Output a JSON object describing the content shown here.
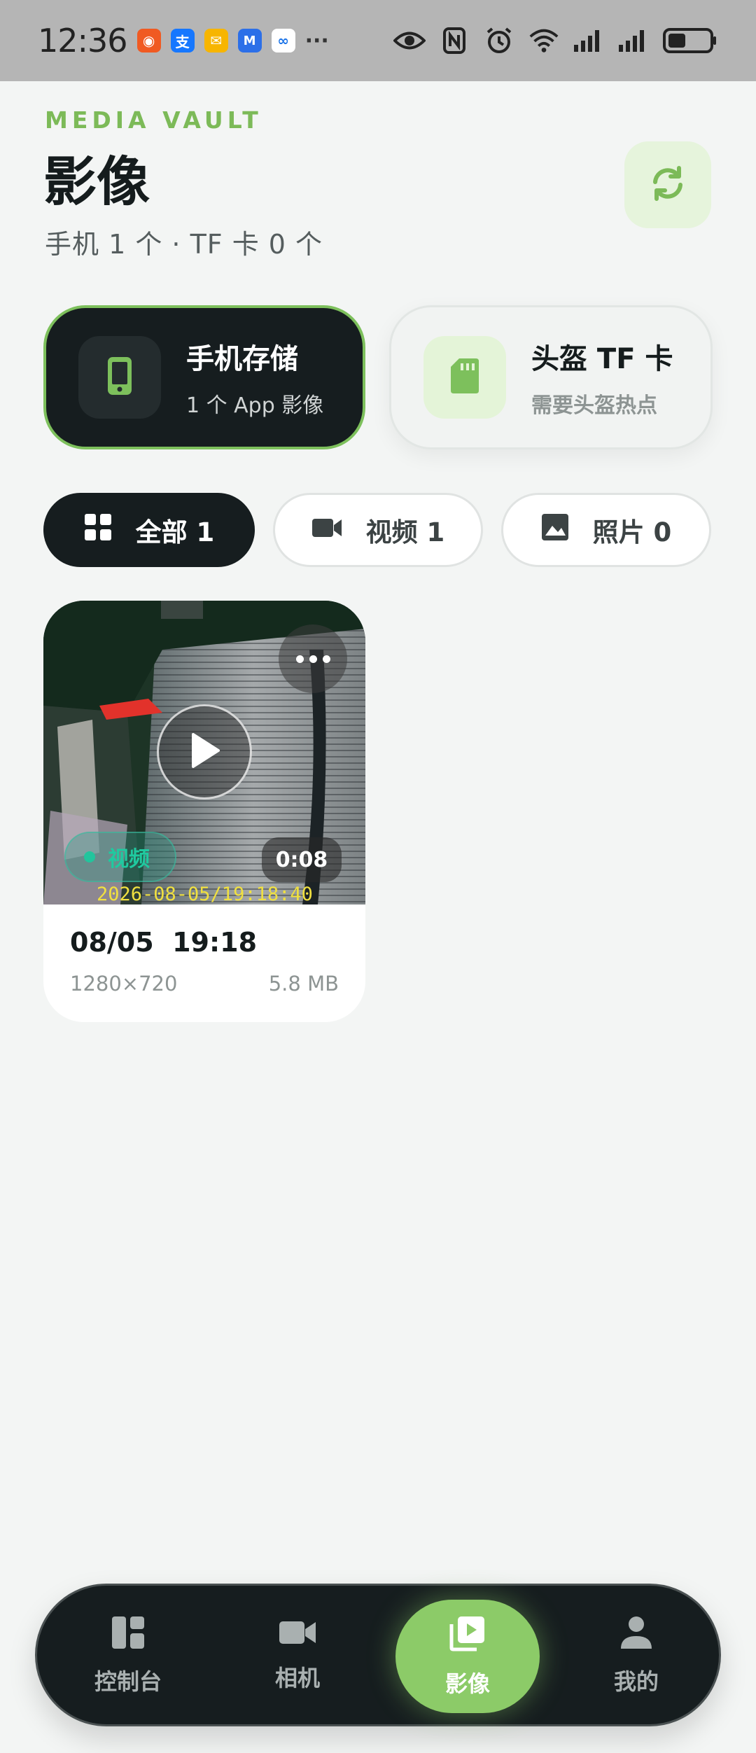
{
  "status_bar": {
    "time": "12:36",
    "more": "···"
  },
  "header": {
    "eyebrow": "MEDIA VAULT",
    "title": "影像",
    "subtitle": "手机 1 个 · TF 卡 0 个"
  },
  "storage": [
    {
      "title": "手机存储",
      "subtitle": "1 个 App 影像",
      "icon": "phone-icon",
      "active": true
    },
    {
      "title": "头盔 TF 卡",
      "subtitle": "需要头盔热点",
      "icon": "sd-card-icon",
      "active": false
    }
  ],
  "filters": [
    {
      "label": "全部 1",
      "icon": "grid-icon",
      "active": true
    },
    {
      "label": "视频 1",
      "icon": "video-camera-icon",
      "active": false
    },
    {
      "label": "照片 0",
      "icon": "image-icon",
      "active": false
    }
  ],
  "media": [
    {
      "type_badge": "视频",
      "duration": "0:08",
      "stamp": "2026-08-05/19:18:40",
      "date": "08/05  19:18",
      "resolution": "1280×720",
      "size": "5.8 MB"
    }
  ],
  "nav": [
    {
      "label": "控制台",
      "icon": "dashboard-icon",
      "active": false
    },
    {
      "label": "相机",
      "icon": "video-camera-icon",
      "active": false
    },
    {
      "label": "影像",
      "icon": "media-library-icon",
      "active": true
    },
    {
      "label": "我的",
      "icon": "person-icon",
      "active": false
    }
  ],
  "colors": {
    "accent": "#7dc05c",
    "dark": "#161d1f",
    "background": "#f3f5f4"
  }
}
